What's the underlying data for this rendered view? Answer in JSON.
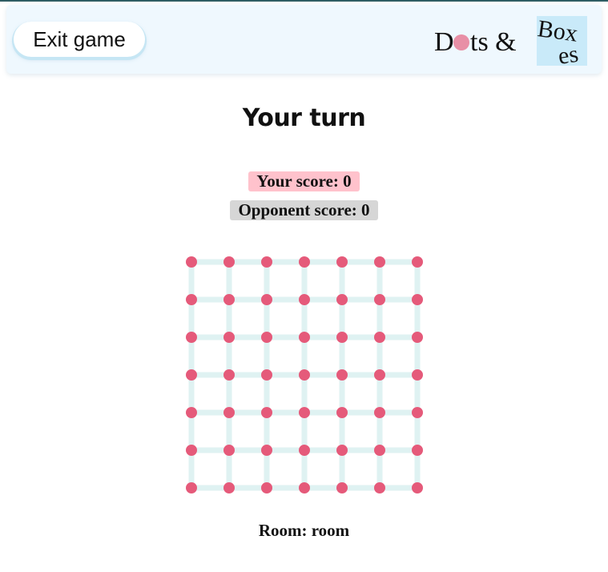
{
  "header": {
    "exit_label": "Exit game",
    "logo": {
      "part1": "D",
      "part2": "ts &",
      "word_box_top": "Box",
      "word_box_bottom": "es"
    }
  },
  "status": {
    "turn": "Your turn",
    "your_score_label": "Your score: 0",
    "opponent_score_label": "Opponent score: 0"
  },
  "game": {
    "dots_per_side": 7,
    "claimed_lines": [],
    "colors": {
      "dot": "#e55a7a",
      "line": "#dff2f2",
      "your_score_bg": "#ffc2cc",
      "opponent_score_bg": "#d6d6d6",
      "logo_dot": "#e88fa6",
      "logo_box_bg": "#c9eaf9"
    }
  },
  "footer": {
    "room_label": "Room: room"
  }
}
